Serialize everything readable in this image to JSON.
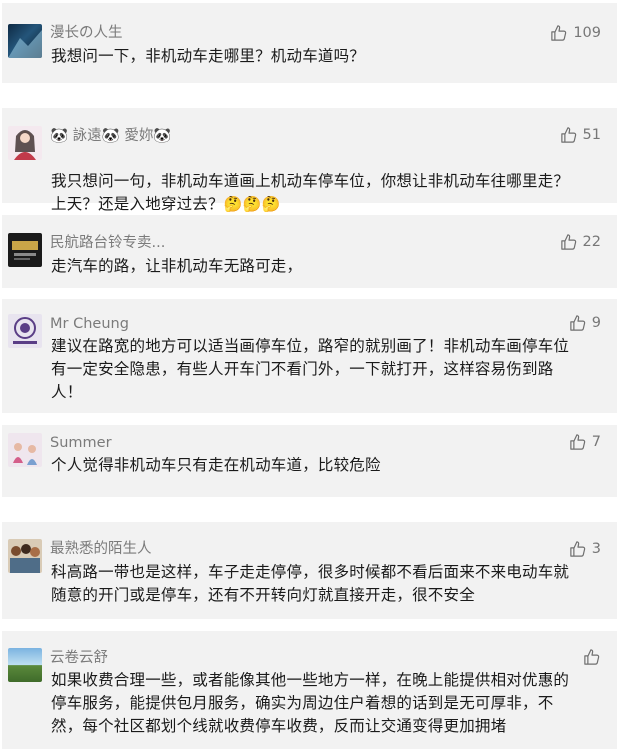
{
  "comments": [
    {
      "name": "漫长の人生",
      "likes": "109",
      "text": "我想问一下，非机动车走哪里？机动车道吗？"
    },
    {
      "name": "🐼 詠遠🐼 愛妳🐼",
      "likes": "51",
      "text": "我只想问一句，非机动车道画上机动车停车位，你想让非机动车往哪里走？\n上天？还是入地穿过去？",
      "emoji": "🤔🤔🤔"
    },
    {
      "name": "民航路台铃专卖...",
      "likes": "22",
      "text": "走汽车的路，让非机动车无路可走，"
    },
    {
      "name": "Mr Cheung",
      "likes": "9",
      "text": "建议在路宽的地方可以适当画停车位，路窄的就别画了！非机动车画停车位\n有一定安全隐患，有些人开车门不看门外，一下就打开，这样容易伤到路\n人！"
    },
    {
      "name": "Summer",
      "likes": "7",
      "text": "个人觉得非机动车只有走在机动车道，比较危险"
    },
    {
      "name": "最熟悉的陌生人",
      "likes": "3",
      "text": "科高路一带也是这样，车子走走停停，很多时候都不看后面来不来电动车就\n随意的开门或是停车，还有不开转向灯就直接开走，很不安全"
    },
    {
      "name": "云卷云舒",
      "likes": "",
      "text": "如果收费合理一些，或者能像其他一些地方一样，在晚上能提供相对优惠的\n停车服务，能提供包月服务，确实为周边住户着想的话到是无可厚非，不\n然，每个社区都划个线就收费停车收费，反而让交通变得更加拥堵"
    }
  ],
  "icons": {
    "like": "thumbs-up-icon"
  },
  "colors": {
    "card_bg": "#f2f2f2",
    "name": "#7b7b7b",
    "text": "#1a1a1a"
  }
}
